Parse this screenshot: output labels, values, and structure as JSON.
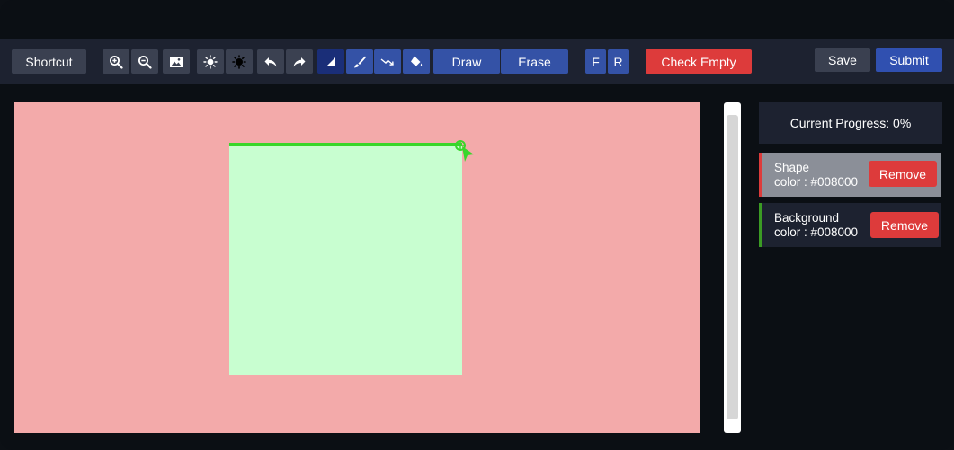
{
  "toolbar": {
    "shortcut_label": "Shortcut",
    "icons": {
      "zoom_in": "zoom-in-icon",
      "zoom_out": "zoom-out-icon",
      "image": "image-icon",
      "brightness_up": "sun-icon",
      "brightness_down": "sun-dark-icon",
      "undo": "undo-icon",
      "redo": "redo-icon",
      "polygon": "polygon-icon",
      "brush": "brush-icon",
      "line": "line-icon",
      "fill": "fill-bucket-icon"
    },
    "draw_label": "Draw",
    "erase_label": "Erase",
    "f_label": "F",
    "r_label": "R",
    "check_empty_label": "Check Empty",
    "save_label": "Save",
    "submit_label": "Submit"
  },
  "canvas": {
    "background_color": "#f3aaaa",
    "shape_color": "#c8fed0",
    "stroke_color": "#38d62a"
  },
  "sidebar": {
    "progress_text": "Current Progress: 0%",
    "layers": [
      {
        "label_line1": "Shape",
        "label_line2": "color : #008000",
        "remove_label": "Remove",
        "accent": "#dd3b3b"
      },
      {
        "label_line1": "Background",
        "label_line2": "color : #008000",
        "remove_label": "Remove",
        "accent": "#3b9b24"
      }
    ]
  },
  "colors": {
    "accent_blue": "#3452a6",
    "danger_red": "#dd3b3b",
    "toolbar_bg": "#1d2230",
    "app_bg": "#0b0f14"
  }
}
